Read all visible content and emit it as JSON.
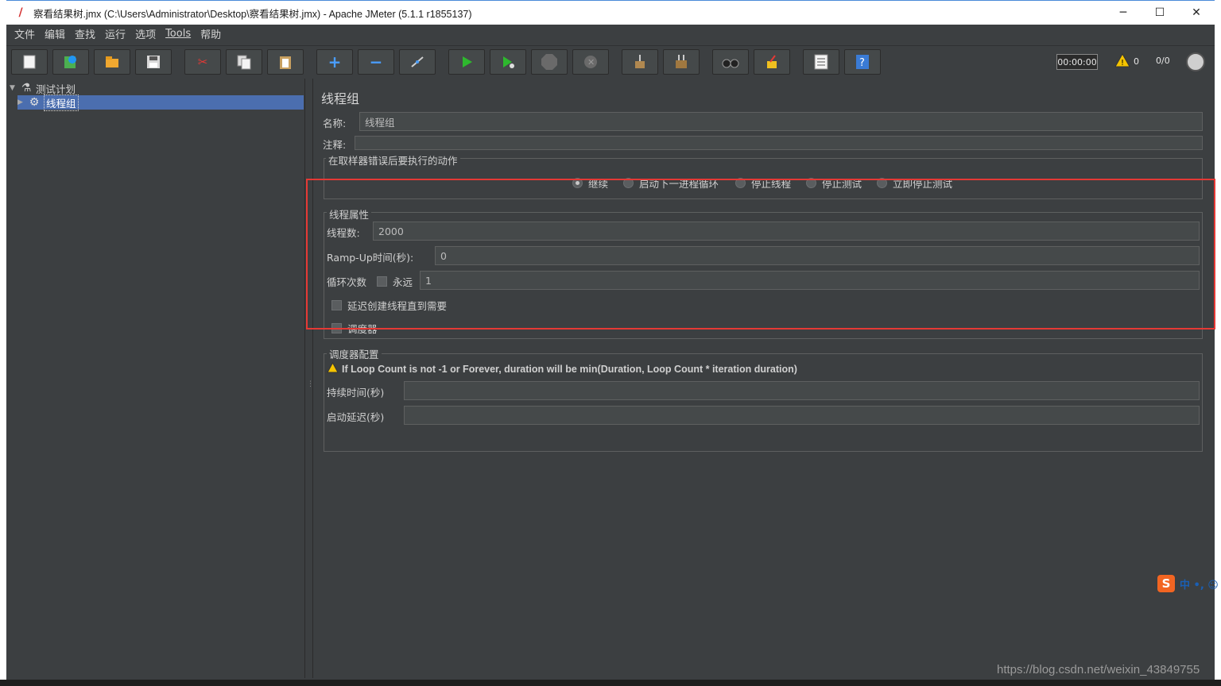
{
  "window": {
    "title": "察看结果树.jmx (C:\\Users\\Administrator\\Desktop\\察看结果树.jmx) - Apache JMeter (5.1.1 r1855137)",
    "minimize": "─",
    "maximize": "☐",
    "close": "✕"
  },
  "menu": [
    "文件",
    "编辑",
    "查找",
    "运行",
    "选项",
    "Tools",
    "帮助"
  ],
  "toolbar": {
    "buttons": [
      {
        "name": "new-button",
        "icon": "new-file-icon"
      },
      {
        "name": "templates-button",
        "icon": "templates-icon"
      },
      {
        "name": "open-button",
        "icon": "open-folder-icon"
      },
      {
        "name": "save-button",
        "icon": "save-icon"
      },
      {
        "name": "cut-button",
        "icon": "scissors-icon"
      },
      {
        "name": "copy-button",
        "icon": "copy-icon"
      },
      {
        "name": "paste-button",
        "icon": "paste-icon"
      },
      {
        "name": "expand-button",
        "icon": "plus-icon"
      },
      {
        "name": "collapse-button",
        "icon": "minus-icon"
      },
      {
        "name": "toggle-button",
        "icon": "toggle-icon"
      },
      {
        "name": "start-button",
        "icon": "play-icon"
      },
      {
        "name": "start-no-pause-button",
        "icon": "play-no-timers-icon"
      },
      {
        "name": "stop-button",
        "icon": "stop-icon"
      },
      {
        "name": "shutdown-button",
        "icon": "shutdown-icon"
      },
      {
        "name": "clear-button",
        "icon": "broom-icon"
      },
      {
        "name": "clear-all-button",
        "icon": "broom-all-icon"
      },
      {
        "name": "search-button",
        "icon": "binoculars-icon"
      },
      {
        "name": "reset-search-button",
        "icon": "reset-search-icon"
      },
      {
        "name": "function-helper-button",
        "icon": "list-icon"
      },
      {
        "name": "help-button",
        "icon": "help-icon"
      }
    ],
    "timer": "00:00:00",
    "warnings": "0",
    "threads": "0/0"
  },
  "tree": {
    "root": "测试计划",
    "child": "线程组"
  },
  "panel": {
    "title": "线程组",
    "name_label": "名称:",
    "name_value": "线程组",
    "comment_label": "注释:",
    "comment_value": "",
    "error_group_title": "在取样器错误后要执行的动作",
    "error_actions": [
      {
        "label": "继续",
        "checked": true
      },
      {
        "label": "启动下一进程循环",
        "checked": false
      },
      {
        "label": "停止线程",
        "checked": false
      },
      {
        "label": "停止测试",
        "checked": false
      },
      {
        "label": "立即停止测试",
        "checked": false
      }
    ],
    "thread_group_title": "线程属性",
    "threads_label": "线程数:",
    "threads_value": "2000",
    "rampup_label": "Ramp-Up时间(秒):",
    "rampup_value": "0",
    "loop_label": "循环次数",
    "forever_label": "永远",
    "loop_value": "1",
    "delay_label": "延迟创建线程直到需要",
    "scheduler_label": "调度器",
    "scheduler_group_title": "调度器配置",
    "scheduler_warning": "If Loop Count is not -1 or Forever, duration will be min(Duration, Loop Count * iteration duration)",
    "duration_label": "持续时间(秒)",
    "duration_value": "",
    "startup_delay_label": "启动延迟(秒)",
    "startup_delay_value": ""
  },
  "watermark": "https://blog.csdn.net/weixin_43849755",
  "ime": {
    "logo": "S",
    "text": "中 •, ☺"
  },
  "colors": {
    "background": "#3c3f41",
    "field": "#45494a",
    "selection": "#4b6eaf",
    "highlight_box": "#e53935"
  }
}
